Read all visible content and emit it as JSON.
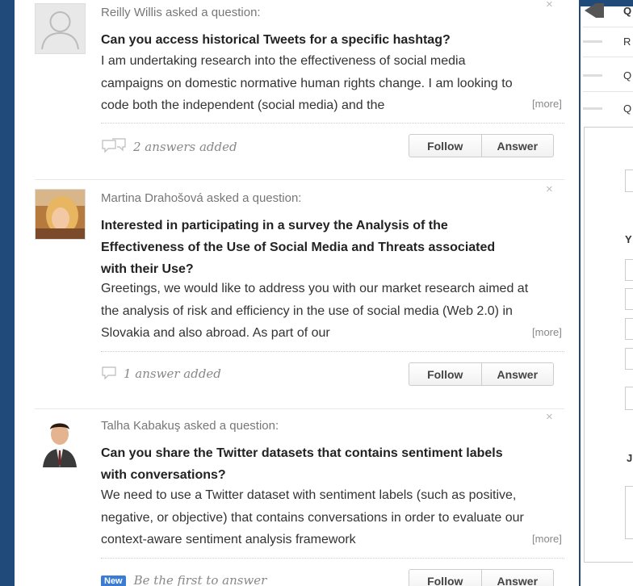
{
  "feed": [
    {
      "asker": "Reilly Willis asked a question:",
      "title": "Can you access historical Tweets for a specific hashtag?",
      "excerpt": "I am undertaking research into the effectiveness of social media campaigns on domestic normative human rights change.  I am looking to code both the independent (social media) and the",
      "more": "[more]",
      "answers": "2 answers added",
      "follow": "Follow",
      "answer": "Answer"
    },
    {
      "asker": "Martina Drahošová asked a question:",
      "close": "×",
      "title": "Interested in participating in a survey the Analysis of the Effectiveness of the Use of Social Media and Threats associated with their Use?",
      "excerpt": "Greetings, we would like to address you with our market research aimed at the analysis of risk and efficiency in the use of social media (Web 2.0) in Slovakia and also abroad. As part of our",
      "more": "[more]",
      "answers": "1 answer added",
      "follow": "Follow",
      "answer": "Answer"
    },
    {
      "asker": "Talha Kabakuş asked a question:",
      "close": "×",
      "title": "Can you share the Twitter datasets that contains sentiment labels with conversations?",
      "excerpt": "We need to use a Twitter dataset with sentiment labels (such as positive, negative, or objective) that contains conversations in order to evaluate our context-aware sentiment analysis framework",
      "more": "[more]",
      "badge": "New",
      "answers": "Be the first to answer",
      "follow": "Follow",
      "answer": "Answer"
    }
  ],
  "right": {
    "items": [
      "Q",
      "R",
      "Q",
      "Q"
    ],
    "heading_y": "Y",
    "heading_j": "J"
  },
  "colors": {
    "page_bg": "#1f4a7a",
    "badge": "#3a7bd5"
  }
}
